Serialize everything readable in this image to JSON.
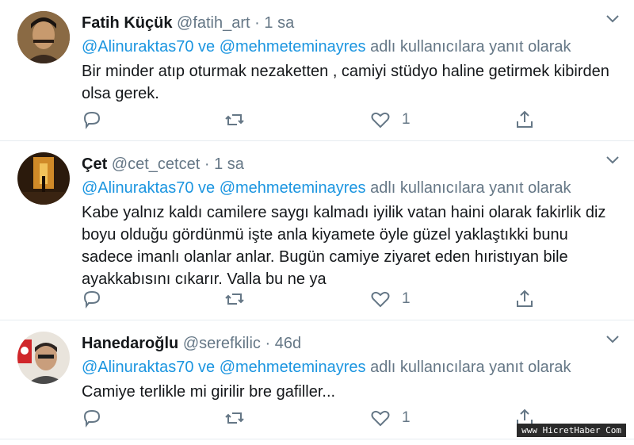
{
  "tweets": [
    {
      "name": "Fatih Küçük",
      "handle": "@fatih_art",
      "sep": "·",
      "time": "1 sa",
      "reply_mention": "@Alinuraktas70 ve @mehmeteminayres",
      "reply_suffix": " adlı kullanıcılara yanıt olarak",
      "text": "Bir minder atıp oturmak nezaketten , camiyi stüdyo haline getirmek kibirden olsa gerek.",
      "like_count": "1"
    },
    {
      "name": "Çet",
      "handle": "@cet_cetcet",
      "sep": "·",
      "time": "1 sa",
      "reply_mention": "@Alinuraktas70 ve @mehmeteminayres",
      "reply_suffix": " adlı kullanıcılara yanıt olarak",
      "text": "Kabe yalnız kaldı camilere saygı kalmadı iyilik vatan haini olarak fakirlik diz boyu olduğu gördünmü işte anla kiyamete öyle güzel yaklaştıkki bunu sadece imanlı olanlar anlar. Bugün camiye ziyaret eden hıristıyan bile ayakkabısını cıkarır. Valla bu ne ya",
      "like_count": "1"
    },
    {
      "name": "Hanedaroğlu",
      "handle": "@serefkilic",
      "sep": "·",
      "time": "46d",
      "reply_mention": "@Alinuraktas70 ve @mehmeteminayres",
      "reply_suffix": " adlı kullanıcılara yanıt olarak",
      "text": "Camiye terlikle mi girilir bre gafiller...",
      "like_count": "1"
    }
  ],
  "watermark": "www HicretHaber Com",
  "colors": {
    "link": "#1b95e0",
    "secondary": "#657786",
    "text": "#14171a",
    "border": "#e6ecf0"
  },
  "icons": [
    "reply-icon",
    "retweet-icon",
    "like-icon",
    "share-icon",
    "chevron-down-icon"
  ]
}
